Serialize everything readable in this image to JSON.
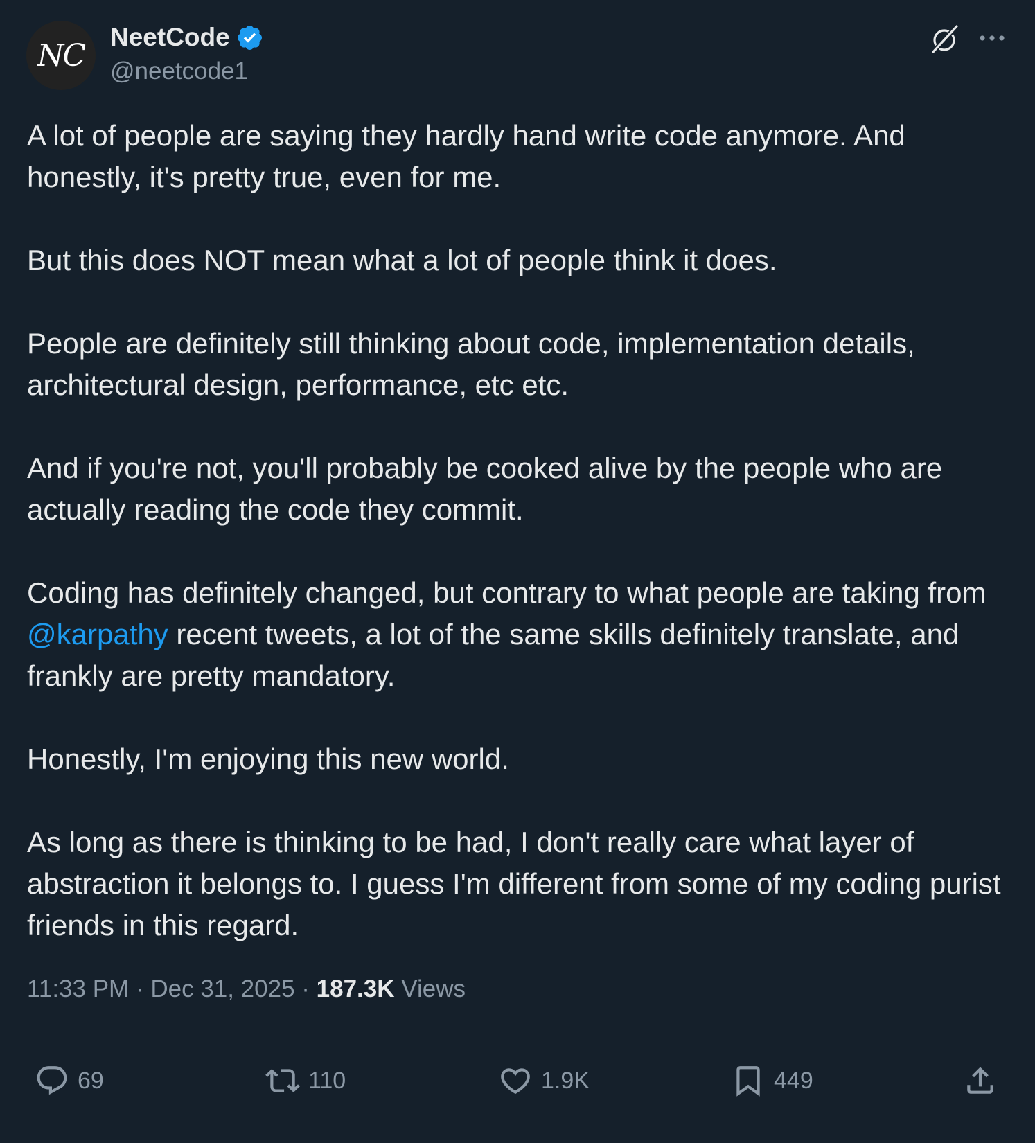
{
  "author": {
    "avatar_text": "NC",
    "name": "NeetCode",
    "handle": "@neetcode1",
    "verified": true
  },
  "tweet": {
    "paragraphs": [
      "A lot of people are saying they hardly hand write code anymore. And honestly, it's pretty true, even for me.",
      "But this does NOT mean what a lot of people think it does.",
      "People are definitely still thinking about code, implementation details, architectural design, performance, etc etc.",
      "And if you're not, you'll probably be cooked alive by the people who are actually reading the code they commit."
    ],
    "para5": {
      "before": "Coding has definitely changed, but contrary to what people are taking from ",
      "mention": "@karpathy",
      "after": " recent tweets, a lot of the same skills definitely translate, and frankly are pretty mandatory."
    },
    "paragraphs_tail": [
      "Honestly, I'm enjoying this new world.",
      "As long as there is thinking to be had, I don't really care what layer of abstraction it belongs to. I guess I'm different from some of my coding purist friends in this regard."
    ]
  },
  "meta": {
    "time": "11:33 PM",
    "separator": " · ",
    "date": "Dec 31, 2025",
    "views_count": "187.3K",
    "views_label": " Views"
  },
  "actions": {
    "replies": "69",
    "reposts": "110",
    "likes": "1.9K",
    "bookmarks": "449"
  },
  "colors": {
    "background": "#15202b",
    "text": "#e7e9ea",
    "secondary": "#8b98a5",
    "accent": "#1d9bf0",
    "divider": "#38444d"
  },
  "icons": [
    "verified-badge-icon",
    "grok-icon",
    "more-icon",
    "reply-icon",
    "repost-icon",
    "like-icon",
    "bookmark-icon",
    "share-icon"
  ]
}
